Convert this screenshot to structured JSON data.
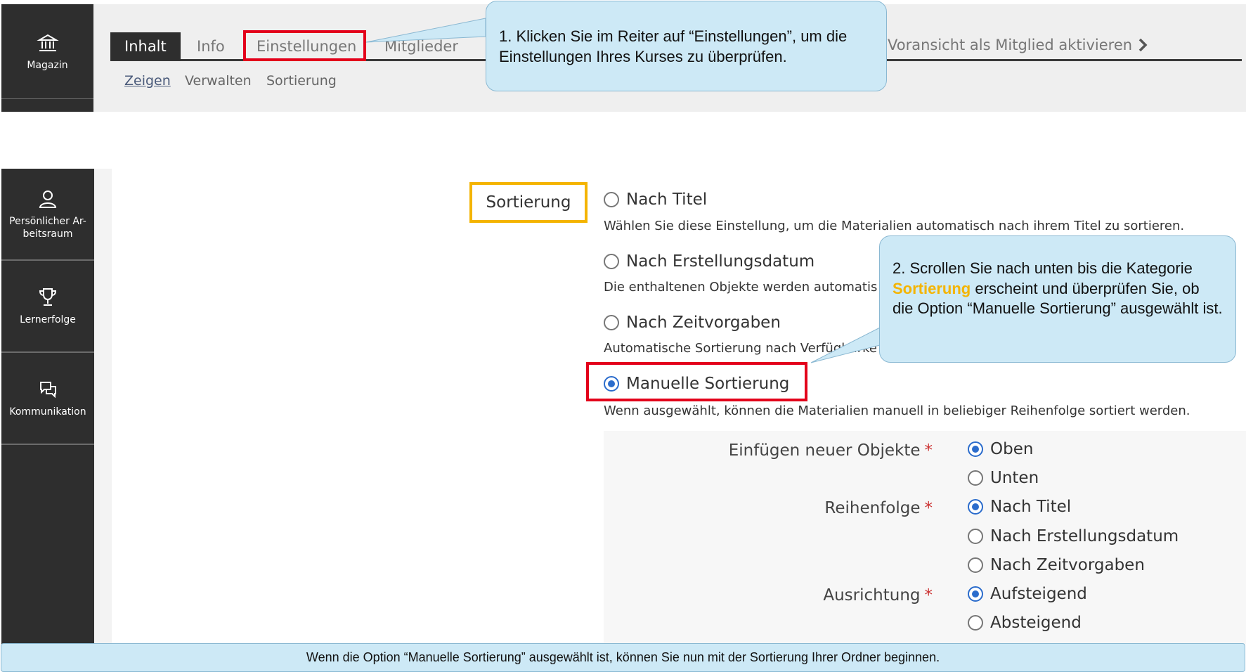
{
  "nav_top": {
    "label": "Magazin",
    "icon": "bank-icon"
  },
  "tabs": [
    {
      "label": "Inhalt",
      "active": true
    },
    {
      "label": "Info",
      "active": false
    },
    {
      "label": "Einstellungen",
      "active": false,
      "highlighted": true
    },
    {
      "label": "Mitglieder",
      "active": false
    }
  ],
  "preview_link": {
    "label": "Voransicht als Mitglied aktivieren",
    "icon": "chevron-right-icon"
  },
  "subtabs": [
    {
      "label": "Zeigen",
      "active": true
    },
    {
      "label": "Verwalten",
      "active": false
    },
    {
      "label": "Sortierung",
      "active": false
    }
  ],
  "callout_1": {
    "text": "1. Klicken Sie im Reiter auf “Einstellungen”, um die Einstellungen Ihres Kurses zu überprüfen."
  },
  "callout_2": {
    "prefix": "2. Scrollen Sie nach unten bis die Kategorie ",
    "highlight": "Sortierung",
    "suffix": " erscheint und überprüfen Sie, ob die Option “Manuelle Sortierung” ausgewählt ist.",
    "highlight_color": "#f4b400"
  },
  "nav_main": [
    {
      "label": "Persönlicher Ar-\nbeitsraum",
      "icon": "user-icon"
    },
    {
      "label": "Lernerfolge",
      "icon": "trophy-icon"
    },
    {
      "label": "Kommunikation",
      "icon": "chat-icon"
    }
  ],
  "sorting": {
    "section_label": "Sortierung",
    "options": [
      {
        "label": "Nach Titel",
        "checked": false,
        "desc": "Wählen Sie diese Einstellung, um die Materialien automatisch nach ihrem Titel zu sortieren."
      },
      {
        "label": "Nach Erstellungsdatum",
        "checked": false,
        "desc": "Die enthaltenen Objekte werden automatis"
      },
      {
        "label": "Nach Zeitvorgaben",
        "checked": false,
        "desc": "Automatische Sortierung nach Verfügbarke"
      },
      {
        "label": "Manuelle Sortierung",
        "checked": true,
        "desc": "Wenn ausgewählt, können die Materialien manuell in beliebiger Reihenfolge sortiert werden."
      }
    ],
    "new_objects": {
      "label": "Einfügen neuer Objekte",
      "required": "*",
      "options": [
        {
          "label": "Oben",
          "checked": true
        },
        {
          "label": "Unten",
          "checked": false
        }
      ]
    },
    "order": {
      "label": "Reihenfolge",
      "required": "*",
      "options": [
        {
          "label": "Nach Titel",
          "checked": true
        },
        {
          "label": "Nach Erstellungsdatum",
          "checked": false
        },
        {
          "label": "Nach Zeitvorgaben",
          "checked": false
        }
      ]
    },
    "direction": {
      "label": "Ausrichtung",
      "required": "*",
      "options": [
        {
          "label": "Aufsteigend",
          "checked": true
        },
        {
          "label": "Absteigend",
          "checked": false
        }
      ]
    }
  },
  "bottom_note": "Wenn die Option “Manuelle Sortierung” ausgewählt ist, können Sie nun mit der Sortierung Ihrer Ordner beginnen.",
  "colors": {
    "nav_bg": "#2e2e2e",
    "highlight_red": "#e3001b",
    "highlight_yellow": "#f4b400",
    "callout_bg": "#cde9f6",
    "radio_blue": "#2b6ccc"
  }
}
